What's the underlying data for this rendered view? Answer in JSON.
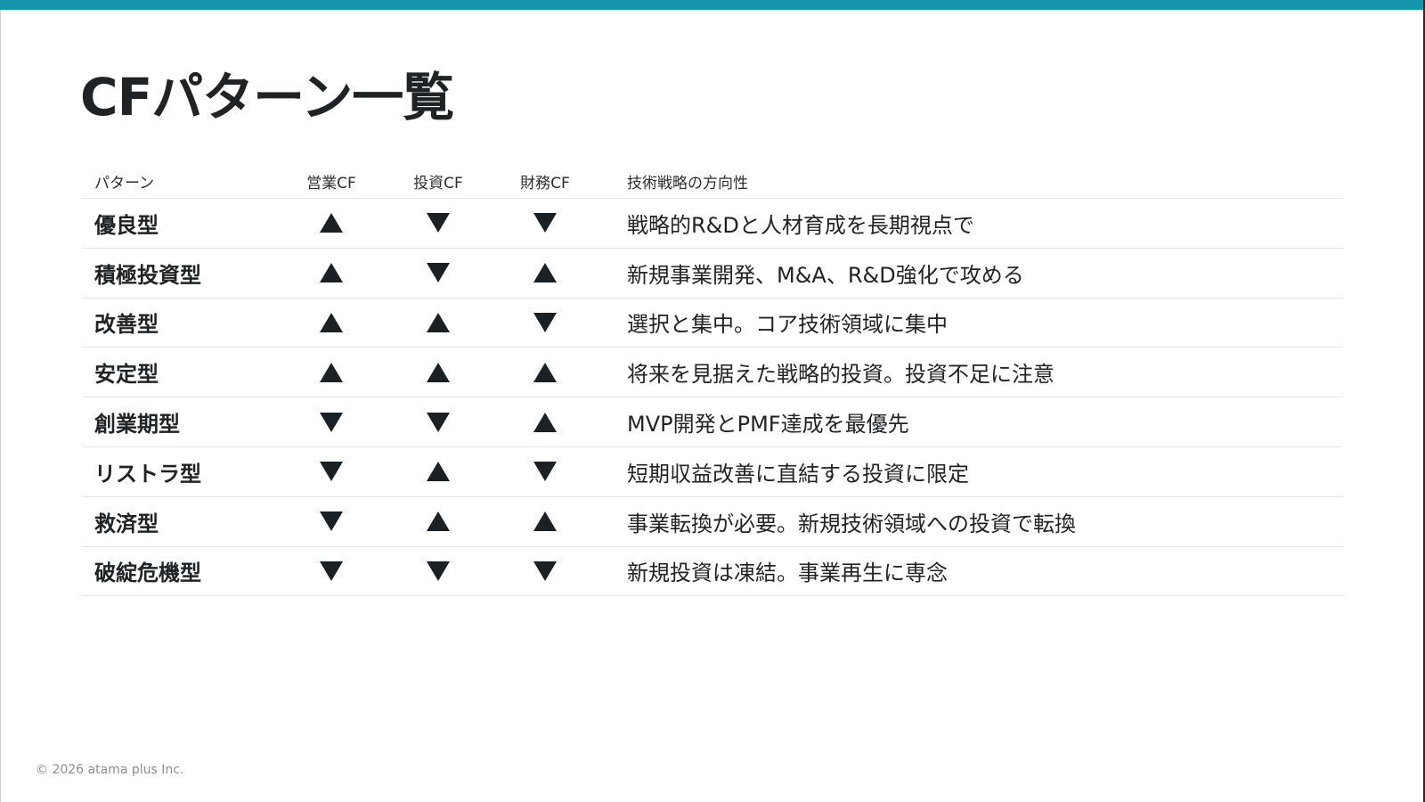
{
  "slide": {
    "accent_color": "#1596ad",
    "title": "CFパターン一覧",
    "footer": "© 2026 atama plus Inc."
  },
  "table": {
    "headers": {
      "pattern": "パターン",
      "operating": "営業CF",
      "investing": "投資CF",
      "financing": "財務CF",
      "strategy": "技術戦略の方向性"
    },
    "rows": [
      {
        "pattern": "優良型",
        "operating": "up",
        "investing": "down",
        "financing": "down",
        "strategy": "戦略的R&Dと人材育成を長期視点で"
      },
      {
        "pattern": "積極投資型",
        "operating": "up",
        "investing": "down",
        "financing": "up",
        "strategy": "新規事業開発、M&A、R&D強化で攻める"
      },
      {
        "pattern": "改善型",
        "operating": "up",
        "investing": "up",
        "financing": "down",
        "strategy": "選択と集中。コア技術領域に集中"
      },
      {
        "pattern": "安定型",
        "operating": "up",
        "investing": "up",
        "financing": "up",
        "strategy": "将来を見据えた戦略的投資。投資不足に注意"
      },
      {
        "pattern": "創業期型",
        "operating": "down",
        "investing": "down",
        "financing": "up",
        "strategy": "MVP開発とPMF達成を最優先"
      },
      {
        "pattern": "リストラ型",
        "operating": "down",
        "investing": "up",
        "financing": "down",
        "strategy": "短期収益改善に直結する投資に限定"
      },
      {
        "pattern": "救済型",
        "operating": "down",
        "investing": "up",
        "financing": "up",
        "strategy": "事業転換が必要。新規技術領域への投資で転換"
      },
      {
        "pattern": "破綻危機型",
        "operating": "down",
        "investing": "down",
        "financing": "down",
        "strategy": "新規投資は凍結。事業再生に専念"
      }
    ]
  }
}
